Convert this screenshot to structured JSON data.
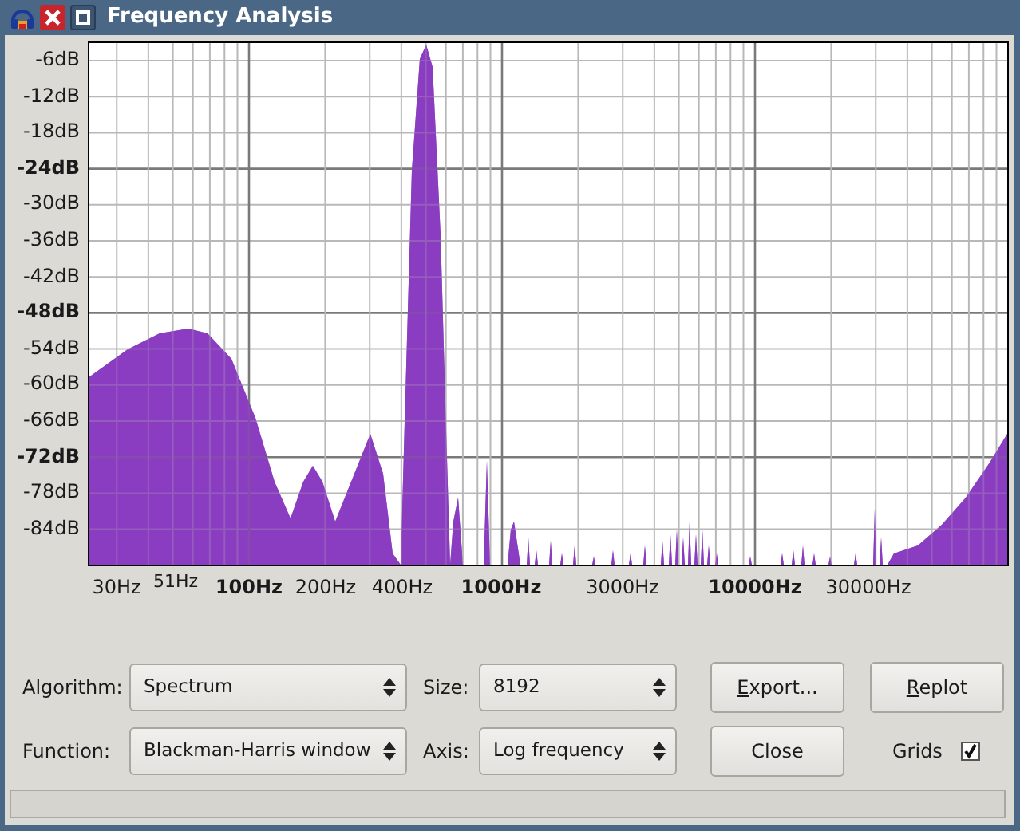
{
  "window": {
    "title": "Frequency Analysis"
  },
  "plot": {
    "y_axis_labels": [
      {
        "text": "-6dB",
        "major": false
      },
      {
        "text": "-12dB",
        "major": false
      },
      {
        "text": "-18dB",
        "major": false
      },
      {
        "text": "-24dB",
        "major": true
      },
      {
        "text": "-30dB",
        "major": false
      },
      {
        "text": "-36dB",
        "major": false
      },
      {
        "text": "-42dB",
        "major": false
      },
      {
        "text": "-48dB",
        "major": true
      },
      {
        "text": "-54dB",
        "major": false
      },
      {
        "text": "-60dB",
        "major": false
      },
      {
        "text": "-66dB",
        "major": false
      },
      {
        "text": "-72dB",
        "major": true
      },
      {
        "text": "-78dB",
        "major": false
      },
      {
        "text": "-84dB",
        "major": false
      }
    ],
    "x_axis_labels": [
      {
        "text": "30Hz",
        "kind": "normal"
      },
      {
        "text": "51Hz",
        "kind": "small"
      },
      {
        "text": "100Hz",
        "kind": "major"
      },
      {
        "text": "200Hz",
        "kind": "normal"
      },
      {
        "text": "400Hz",
        "kind": "normal"
      },
      {
        "text": "1000Hz",
        "kind": "major"
      },
      {
        "text": "3000Hz",
        "kind": "normal"
      },
      {
        "text": "10000Hz",
        "kind": "major"
      },
      {
        "text": "30000Hz",
        "kind": "normal"
      }
    ]
  },
  "controls": {
    "algorithm": {
      "label": "Algorithm:",
      "value": "Spectrum"
    },
    "size": {
      "label": "Size:",
      "value": "8192"
    },
    "function": {
      "label": "Function:",
      "value": "Blackman-Harris window"
    },
    "axis": {
      "label": "Axis:",
      "value": "Log frequency"
    },
    "buttons": [
      {
        "label": "Export...",
        "underline_first": true
      },
      {
        "label": "Replot",
        "underline_first": true
      },
      {
        "label": "Close",
        "underline_first": false
      }
    ],
    "grids": {
      "label": "Grids",
      "checked": true
    }
  }
}
